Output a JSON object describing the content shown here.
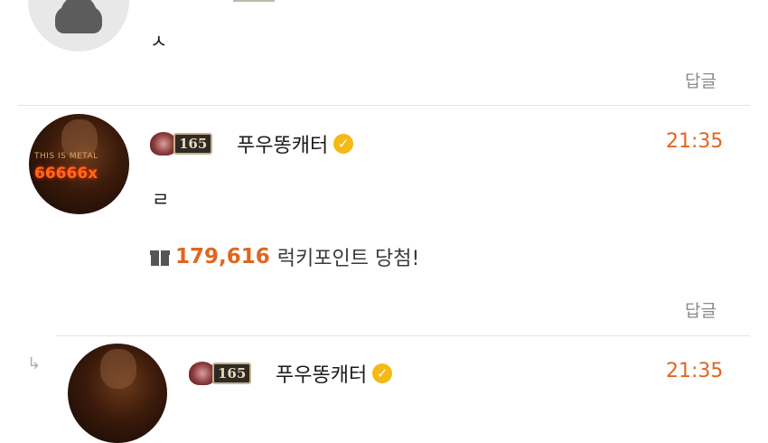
{
  "comments": [
    {
      "body": "ㅅ",
      "reply_label": "답글"
    },
    {
      "level": "165",
      "username": "푸우똥캐터",
      "time": "21:35",
      "body": "ㄹ",
      "avatar_text_top": "THIS IS METAL",
      "avatar_text_bottom": "66666x",
      "lucky_points": "179,616",
      "lucky_label": "럭키포인트 당첨!",
      "reply_label": "답글"
    },
    {
      "level": "165",
      "username": "푸우똥캐터",
      "time": "21:35",
      "reply_arrow": "↳"
    }
  ],
  "colors": {
    "accent": "#e0661e",
    "verified": "#f5b915",
    "muted": "#8a8a8a"
  }
}
